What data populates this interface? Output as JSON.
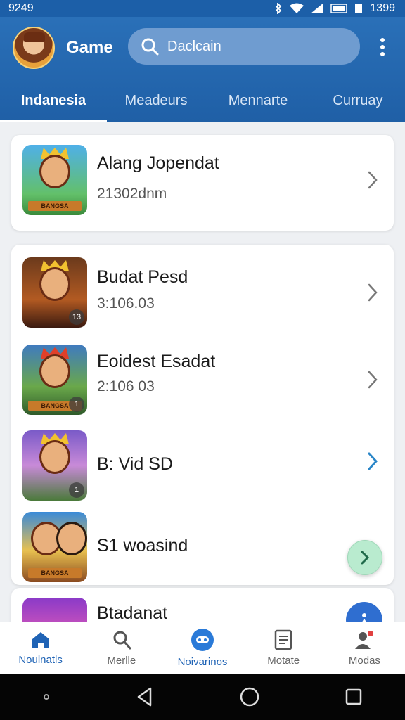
{
  "status_bar": {
    "time": "9249",
    "battery": "1399"
  },
  "app_bar": {
    "title": "Game",
    "search_placeholder": "Daclcain"
  },
  "tabs": [
    {
      "label": "Indanesia",
      "active": true
    },
    {
      "label": "Meadeurs",
      "active": false
    },
    {
      "label": "Mennarte",
      "active": false
    },
    {
      "label": "Curruay",
      "active": false
    }
  ],
  "items": [
    {
      "title": "Alang Jopendat",
      "subtitle": "21302dnm",
      "chevron_color": "#777777"
    },
    {
      "title": "Budat Pesd",
      "subtitle": "3:106.03",
      "badge": "13",
      "chevron_color": "#777777"
    },
    {
      "title": "Eoidest Esadat",
      "subtitle": "2:106 03",
      "badge": "1",
      "chevron_color": "#777777"
    },
    {
      "title": "B:  Vid SD",
      "subtitle": "",
      "badge": "1",
      "chevron_color": "#2a86c8"
    },
    {
      "title": "S1  woasind",
      "subtitle": "",
      "chevron_color": "#2a8a5a"
    },
    {
      "title": "Btadanat",
      "subtitle": ""
    }
  ],
  "bottom_nav": [
    {
      "label": "Noulnatls",
      "icon": "home-icon",
      "active": true
    },
    {
      "label": "Merlle",
      "icon": "search-icon",
      "active": false
    },
    {
      "label": "Noivarinos",
      "icon": "game-icon",
      "active": true
    },
    {
      "label": "Motate",
      "icon": "document-icon",
      "active": false
    },
    {
      "label": "Modas",
      "icon": "profile-icon",
      "active": false
    }
  ],
  "colors": {
    "app_bar": "#1f5fa6",
    "accent": "#1f63b5",
    "fab": "#b9ebcf"
  }
}
